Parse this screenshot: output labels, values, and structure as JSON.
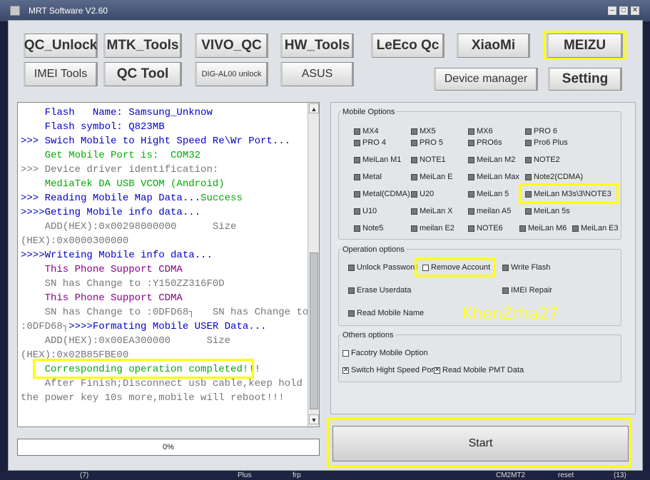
{
  "window": {
    "title": "MRT Software V2.60",
    "min": "–",
    "max": "□",
    "close": "✕"
  },
  "toolbar": {
    "qc_unlock": "QC_Unlock",
    "mtk_tools": "MTK_Tools",
    "vivo_qc": "VIVO_QC",
    "hw_tools": "HW_Tools",
    "leeco_qc": "LeEco Qc",
    "xiaomi": "XiaoMi",
    "meizu": "MEIZU",
    "imei_tools": "IMEI Tools",
    "qc_tool": "QC Tool",
    "dig_al00": "DIG-AL00 unlock",
    "asus": "ASUS",
    "device_manager": "Device manager",
    "setting": "Setting"
  },
  "log": {
    "lines": [
      {
        "text": "    Flash   Name: Samsung_Unknow",
        "color": "#0000cc"
      },
      {
        "text": "    Flash symbol: Q823MB",
        "color": "#0000cc"
      },
      {
        "text": ">>> Swich Mobile to Hight Speed Re\\Wr Port...",
        "color": "#0000cc"
      },
      {
        "text": "    Get Mobile Port is:  COM32",
        "color": "#00aa00"
      },
      {
        "text": ">>> Device driver identification:",
        "color": "#777777"
      },
      {
        "text": "    MediaTek DA USB VCOM (Android)",
        "color": "#00aa00"
      },
      {
        "text": ">>> Reading Mobile Map Data...",
        "color": "#0000cc",
        "suffix": "Success",
        "suffix_color": "#00aa00"
      },
      {
        "text": ">>>>Geting Mobile info data...",
        "color": "#0000cc"
      },
      {
        "text": "    ADD(HEX):0x00298000000      Size",
        "color": "#777777"
      },
      {
        "text": "(HEX):0x0000300000",
        "color": "#777777"
      },
      {
        "text": ">>>>Writeing Mobile info data...",
        "color": "#0000cc"
      },
      {
        "text": "    This Phone Support CDMA",
        "color": "#880088"
      },
      {
        "text": "    SN has Change to :Y150ZZ316F0D",
        "color": "#777777"
      },
      {
        "text": "    This Phone Support CDMA",
        "color": "#880088"
      },
      {
        "text": "    SN has Change to :0DFD68┐   SN has Change to",
        "color": "#777777"
      },
      {
        "text": ":0DFD68┐",
        "color": "#777777",
        "suffix": ">>>>Formating Mobile USER Data...",
        "suffix_color": "#0000cc"
      },
      {
        "text": "    ADD(HEX):0x00EA300000      Size",
        "color": "#777777"
      },
      {
        "text": "(HEX):0x02B85FBE00",
        "color": "#777777"
      },
      {
        "text": "    Corresponding operation completed!!!",
        "color": "#00aa00"
      },
      {
        "text": "    After Finish;Disconnect usb cable,keep hold",
        "color": "#777777"
      },
      {
        "text": "the power key 10s more,mobile will reboot!!!",
        "color": "#777777"
      }
    ]
  },
  "progress": {
    "label": "0%",
    "fraction": 0
  },
  "mobile_options": {
    "title": "Mobile Options",
    "items": [
      "MX4",
      "MX5",
      "MX6",
      "PRO 6",
      "PRO 4",
      "PRO 5",
      "PRO6s",
      "Pro6 Plus",
      "MeiLan M1",
      "NOTE1",
      "MeiLan M2",
      "NOTE2",
      "Metal",
      "MeiLan E",
      "MeiLan Max",
      "Note2(CDMA)",
      "Metal(CDMA)",
      "U20",
      "MeiLan 5",
      "MeiLan M3s\\3\\NOTE3",
      "U10",
      "MeiLan X",
      "meilan A5",
      "MeiLan 5s",
      "Note5",
      "meilan E2",
      "NOTE6",
      "MeiLan M6",
      "MeiLan E3"
    ]
  },
  "operation_options": {
    "title": "Operation options",
    "unlock_password": "Unlock Password",
    "remove_account": "Remove Account",
    "write_flash": "Write Flash",
    "erase_userdata": "Erase Userdata",
    "imei_repair": "IMEI Repair",
    "read_mobile_name": "Read Mobile Name"
  },
  "others_options": {
    "title": "Others options",
    "factory_mobile_option": "Facotry Mobile Option",
    "switch_hight_speed": "Switch Hight Speed Por",
    "read_mobile_pmt": "Read Mobile PMT Data"
  },
  "watermark": "KhenZrha27",
  "start_button": "Start",
  "taskbar": {
    "t1": "(7)",
    "t2": "Plus",
    "t3": "frp",
    "t4": "CM2MT2",
    "t5": "reset",
    "t6": "(13)"
  }
}
